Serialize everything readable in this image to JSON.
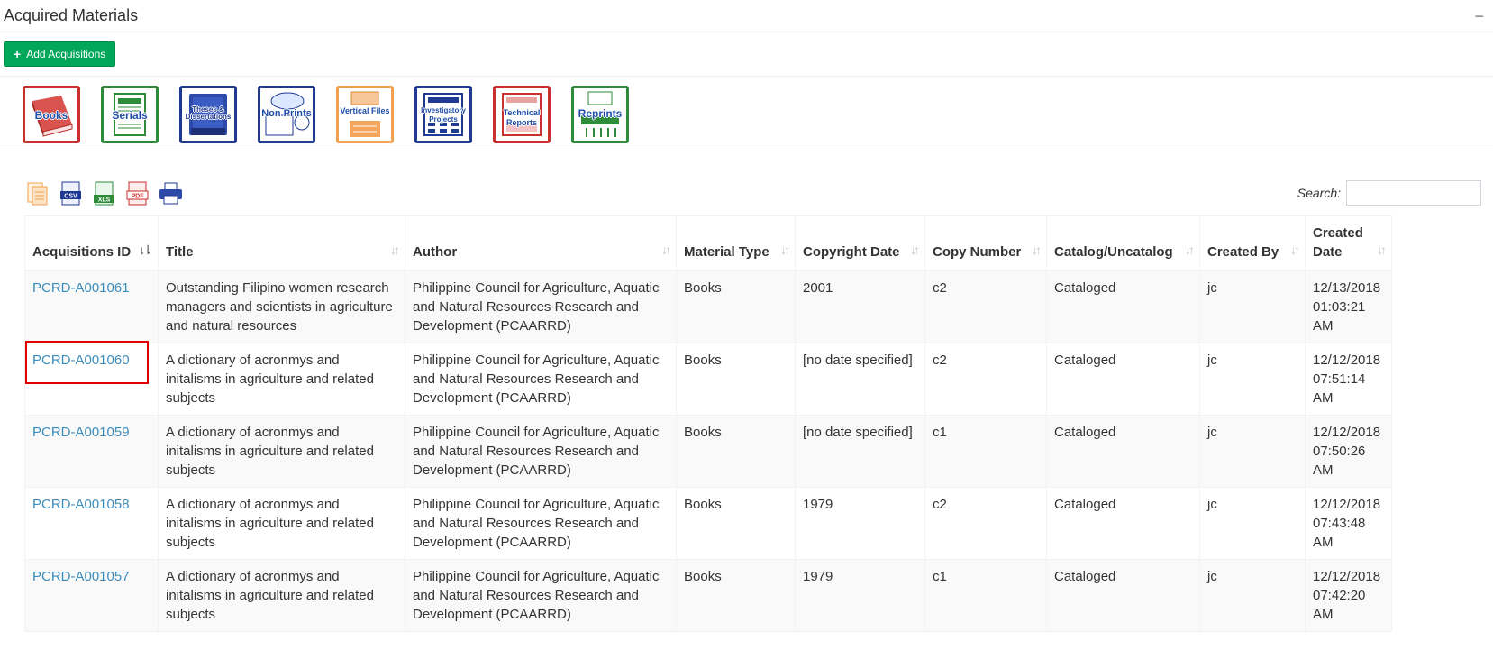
{
  "panel": {
    "title": "Acquired Materials",
    "collapse_symbol": "−"
  },
  "toolbar": {
    "add_label": "Add Acquisitions",
    "add_icon": "plus-icon"
  },
  "categories": [
    {
      "label": "Books",
      "color": "#c9302c",
      "icon": "book-icon"
    },
    {
      "label": "Serials",
      "color": "#2e8b3a",
      "icon": "serials-icon"
    },
    {
      "label": "Theses & Dissertations",
      "color": "#1f3a93",
      "icon": "theses-icon"
    },
    {
      "label": "Non Prints",
      "color": "#1f3a93",
      "icon": "non-prints-icon"
    },
    {
      "label": "Vertical Files",
      "color": "#f0a050",
      "icon": "vertical-files-icon"
    },
    {
      "label": "Investigatory Projects",
      "color": "#1f3a93",
      "icon": "investigatory-icon"
    },
    {
      "label": "Technical Reports",
      "color": "#c9302c",
      "icon": "technical-reports-icon"
    },
    {
      "label": "Reprints",
      "color": "#2e8b3a",
      "icon": "reprints-icon"
    }
  ],
  "exports": [
    {
      "name": "copy",
      "icon": "copy-icon"
    },
    {
      "name": "csv",
      "icon": "csv-icon",
      "text": "CSV"
    },
    {
      "name": "xls",
      "icon": "xls-icon",
      "text": "XLS"
    },
    {
      "name": "pdf",
      "icon": "pdf-icon",
      "text": "PDF"
    },
    {
      "name": "print",
      "icon": "print-icon"
    }
  ],
  "search": {
    "label": "Search:",
    "value": "",
    "placeholder": ""
  },
  "table": {
    "columns": [
      {
        "label": "Acquisitions ID",
        "sort": "active"
      },
      {
        "label": "Title"
      },
      {
        "label": "Author"
      },
      {
        "label": "Material Type"
      },
      {
        "label": "Copyright Date"
      },
      {
        "label": "Copy Number"
      },
      {
        "label": "Catalog/Uncatalog"
      },
      {
        "label": "Created By"
      },
      {
        "label": "Created Date"
      }
    ],
    "rows": [
      {
        "id": "PCRD-A001061",
        "title": "Outstanding Filipino women research managers and scientists in agriculture and natural resources",
        "author": "Philippine Council for Agriculture, Aquatic and Natural Resources Research and Development (PCAARRD)",
        "material_type": "Books",
        "copyright_date": "2001",
        "copy_number": "c2",
        "catalog": "Cataloged",
        "created_by": "jc",
        "created_date": "12/13/2018 01:03:21 AM"
      },
      {
        "id": "PCRD-A001060",
        "title": "A dictionary of acronmys and initalisms in agriculture and related subjects",
        "author": "Philippine Council for Agriculture, Aquatic and Natural Resources Research and Development (PCAARRD)",
        "material_type": "Books",
        "copyright_date": "[no date specified]",
        "copy_number": "c2",
        "catalog": "Cataloged",
        "created_by": "jc",
        "created_date": "12/12/2018 07:51:14 AM"
      },
      {
        "id": "PCRD-A001059",
        "title": "A dictionary of acronmys and initalisms in agriculture and related subjects",
        "author": "Philippine Council for Agriculture, Aquatic and Natural Resources Research and Development (PCAARRD)",
        "material_type": "Books",
        "copyright_date": "[no date specified]",
        "copy_number": "c1",
        "catalog": "Cataloged",
        "created_by": "jc",
        "created_date": "12/12/2018 07:50:26 AM"
      },
      {
        "id": "PCRD-A001058",
        "title": "A dictionary of acronmys and initalisms in agriculture and related subjects",
        "author": "Philippine Council for Agriculture, Aquatic and Natural Resources Research and Development (PCAARRD)",
        "material_type": "Books",
        "copyright_date": "1979",
        "copy_number": "c2",
        "catalog": "Cataloged",
        "created_by": "jc",
        "created_date": "12/12/2018 07:43:48 AM"
      },
      {
        "id": "PCRD-A001057",
        "title": "A dictionary of acronmys and initalisms in agriculture and related subjects",
        "author": "Philippine Council for Agriculture, Aquatic and Natural Resources Research and Development (PCAARRD)",
        "material_type": "Books",
        "copyright_date": "1979",
        "copy_number": "c1",
        "catalog": "Cataloged",
        "created_by": "jc",
        "created_date": "12/12/2018 07:42:20 AM"
      }
    ]
  },
  "colors": {
    "accent_green": "#00a65a",
    "link_blue": "#3c8dbc",
    "highlight_red": "#e00000"
  }
}
